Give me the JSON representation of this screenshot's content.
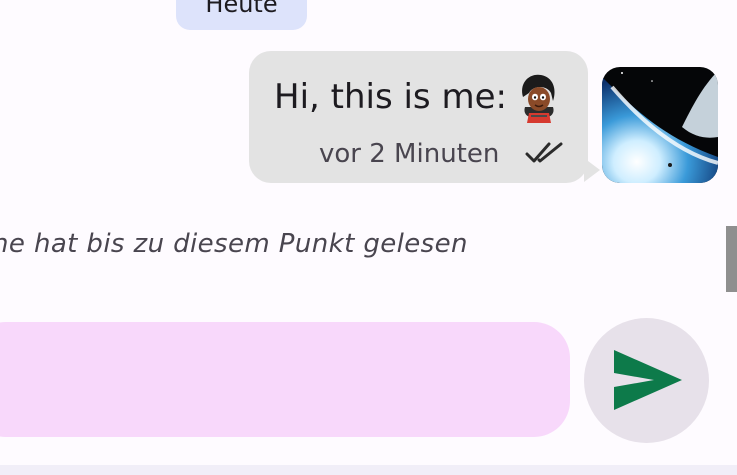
{
  "chat": {
    "date_chip": "Heute",
    "message": {
      "text": "Hi, this is me:",
      "time": "vor 2 Minuten",
      "status_icon": "double-check-icon"
    },
    "read_marker": "ne hat bis zu diesem Punkt gelesen"
  },
  "composer": {
    "send_icon": "send-icon",
    "colors": {
      "field": "#f8d8fb",
      "send_button": "#e7e1ea",
      "send_icon": "#0d7a4a"
    }
  },
  "colors": {
    "date_chip": "#dde3fb",
    "bubble": "#e3e3e3",
    "background": "#fefbff"
  }
}
